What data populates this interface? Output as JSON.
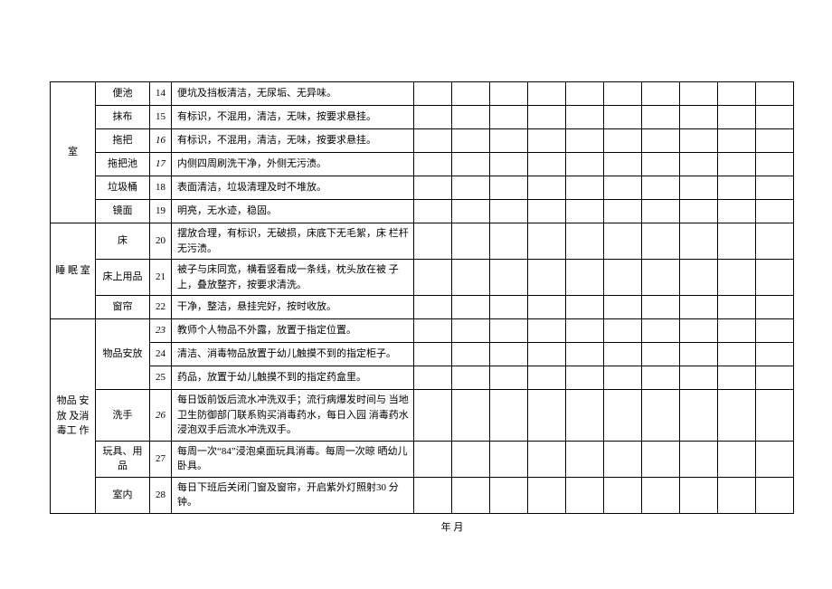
{
  "table": {
    "groups": [
      {
        "category": "室",
        "items": [
          {
            "name": "便池",
            "num": "14",
            "desc": "便坑及挡板清洁，无尿垢、无异味。"
          },
          {
            "name": "抹布",
            "num": "15",
            "desc": "有标识，不混用，清洁，无味，按要求悬挂。"
          },
          {
            "name": "拖把",
            "num": "16",
            "desc": "有标识，不混用，清洁，无味，按要求悬挂。",
            "italic": true
          },
          {
            "name": "拖把池",
            "num": "17",
            "desc": "内侧四周刷洗干净，外侧无污渍。",
            "italic": true
          },
          {
            "name": "垃圾桶",
            "num": "18",
            "desc": "表面清洁，垃圾清理及时不堆放。"
          },
          {
            "name": "镜面",
            "num": "19",
            "desc": "明亮，无水迹，稳固。"
          }
        ]
      },
      {
        "category": "睡 眠 室",
        "items": [
          {
            "name": "床",
            "num": "20",
            "desc": "摆放合理，有标识，无破损，床底下无毛絮，床 栏杆无污渍。"
          },
          {
            "name": "床上用品",
            "num": "21",
            "desc": "被子与床同宽，横看竖看成一条线，枕头放在被 子上，叠放整齐，按要求清洗。"
          },
          {
            "name": "窗帘",
            "num": "22",
            "desc": "干净，整洁，悬挂完好，按时收放。"
          }
        ]
      },
      {
        "category": "物品 安放 及消 毒工 作",
        "items": [
          {
            "name": "物品安放",
            "rows": [
              {
                "num": "23",
                "desc": "教师个人物品不外露，放置于指定位置。",
                "italic": true
              },
              {
                "num": "24",
                "desc": "清洁、消毒物品放置于幼儿触摸不到的指定柜子。"
              },
              {
                "num": "25",
                "desc": "药品，放置于幼儿触摸不到的指定药盒里。"
              }
            ]
          },
          {
            "name": "洗手",
            "num": "26",
            "desc": "每日饭前饭后流水冲洗双手；流行病爆发时间与 当地卫生防御部门联系购买消毒药水，每日入园 消毒药水浸泡双手后流水冲洗双手。",
            "italic": true
          },
          {
            "name": "玩具、用品",
            "num": "27",
            "desc": "每周一次“84”浸泡桌面玩具消毒。每周一次晾 晒幼儿卧具。"
          },
          {
            "name": "室内",
            "num": "28",
            "desc": "每日下班后关闭门窗及窗帘，开启紫外灯照射30 分钟。"
          }
        ]
      }
    ]
  },
  "footer": "年  月"
}
